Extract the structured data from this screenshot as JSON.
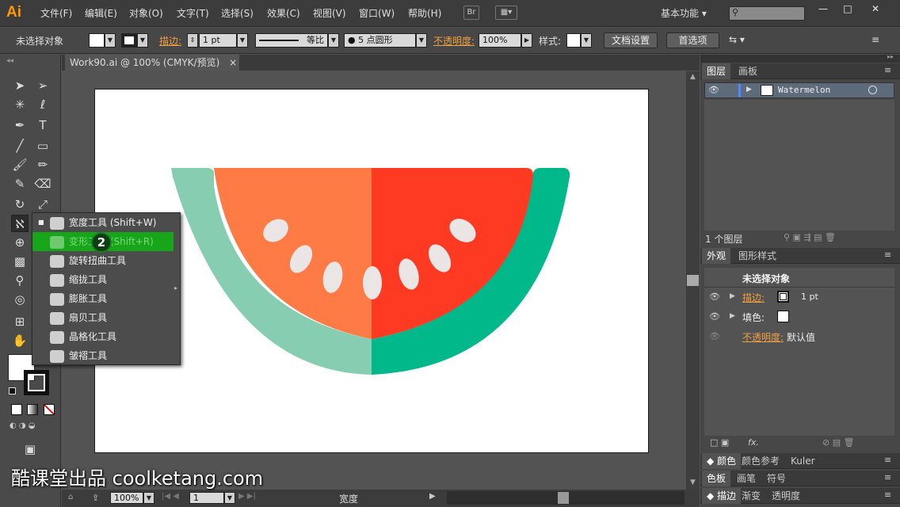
{
  "app": {
    "logo": "Ai"
  },
  "menubar": {
    "items": [
      "文件(F)",
      "编辑(E)",
      "对象(O)",
      "文字(T)",
      "选择(S)",
      "效果(C)",
      "视图(V)",
      "窗口(W)",
      "帮助(H)"
    ],
    "br_label": "Br",
    "workspace": "基本功能",
    "window_controls": [
      "—",
      "□",
      "✕"
    ]
  },
  "controlbar": {
    "selection": "未选择对象",
    "stroke_label": "描边:",
    "stroke_value": "1 pt",
    "stroke_profile": "等比",
    "brush": "5 点圆形",
    "opacity_label": "不透明度:",
    "opacity_value": "100%",
    "style_label": "样式:",
    "doc_setup": "文档设置",
    "preferences": "首选项"
  },
  "document": {
    "tab_title": "Work90.ai @ 100% (CMYK/预览)",
    "close": "×"
  },
  "flyout": {
    "items": [
      {
        "label": "宽度工具  (Shift+W)",
        "icon": "width-tool-icon"
      },
      {
        "label": "变形工具  (Shift+R)",
        "icon": "warp-tool-icon"
      },
      {
        "label": "旋转扭曲工具",
        "icon": "twirl-tool-icon"
      },
      {
        "label": "缩拢工具",
        "icon": "pucker-tool-icon"
      },
      {
        "label": "膨胀工具",
        "icon": "bloat-tool-icon"
      },
      {
        "label": "扇贝工具",
        "icon": "scallop-tool-icon"
      },
      {
        "label": "晶格化工具",
        "icon": "crystallize-tool-icon"
      },
      {
        "label": "皱褶工具",
        "icon": "wrinkle-tool-icon"
      }
    ],
    "step_badge": "2"
  },
  "layers_panel": {
    "tabs": [
      "图层",
      "画板"
    ],
    "layer_name": "Watermelon",
    "footer": "1 个图层"
  },
  "appearance_panel": {
    "tabs": [
      "外观",
      "图形样式"
    ],
    "title": "未选择对象",
    "stroke_label": "描边:",
    "stroke_value": "1 pt",
    "fill_label": "填色:",
    "opacity_label": "不透明度:",
    "opacity_value": "默认值",
    "fx": "fx."
  },
  "collapsed_panels": [
    [
      "颜色",
      "颜色参考",
      "Kuler"
    ],
    [
      "色板",
      "画笔",
      "符号"
    ],
    [
      "描边",
      "渐变",
      "透明度"
    ]
  ],
  "statusbar": {
    "zoom": "100%",
    "page": "1",
    "tool": "宽度"
  },
  "watermark": "酷课堂出品 coolketang.com",
  "colors": {
    "rind_left": "#86cdb2",
    "rind_right": "#00b889",
    "flesh_left": "#ff7b45",
    "flesh_right": "#ff3a22",
    "seed": "#ebe6e5",
    "highlight": "#17a61a"
  }
}
